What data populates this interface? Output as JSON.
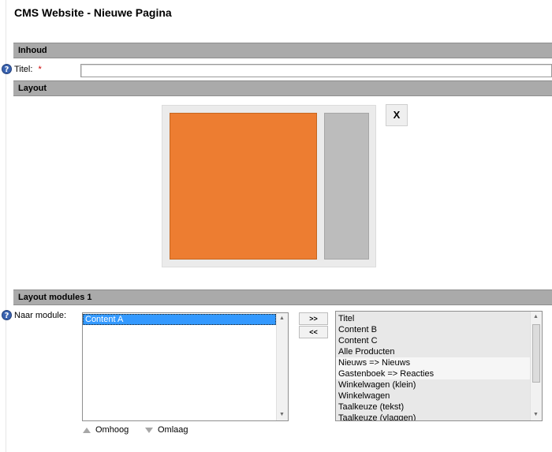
{
  "page": {
    "title": "CMS Website - Nieuwe Pagina"
  },
  "sections": {
    "inhoud": "Inhoud",
    "layout": "Layout",
    "layout_modules": "Layout modules 1"
  },
  "form": {
    "help_glyph": "?",
    "title_label": "Titel:",
    "required_marker": "*",
    "title_value": "",
    "module_label": "Naar module:"
  },
  "layout": {
    "remove_label": "X",
    "colors": {
      "main_block": "#ed7d31",
      "side_block": "#bcbcbc"
    }
  },
  "target_list": {
    "items": [
      "Content A"
    ],
    "selected_index": 0
  },
  "buttons": {
    "add": ">>",
    "remove": "<<"
  },
  "source_list": {
    "items": [
      "Titel",
      "Content B",
      "Content C",
      "Alle Producten",
      "Nieuws => Nieuws",
      "Gastenboek => Reacties",
      "Winkelwagen (klein)",
      "Winkelwagen",
      "Taalkeuze (tekst)",
      "Taalkeuze (vlaggen)"
    ]
  },
  "ordering": {
    "up": "Omhoog",
    "down": "Omlaag"
  },
  "icons": [
    "help-icon",
    "scroll-up-icon",
    "scroll-down-icon",
    "arrow-up-icon",
    "arrow-down-icon"
  ]
}
